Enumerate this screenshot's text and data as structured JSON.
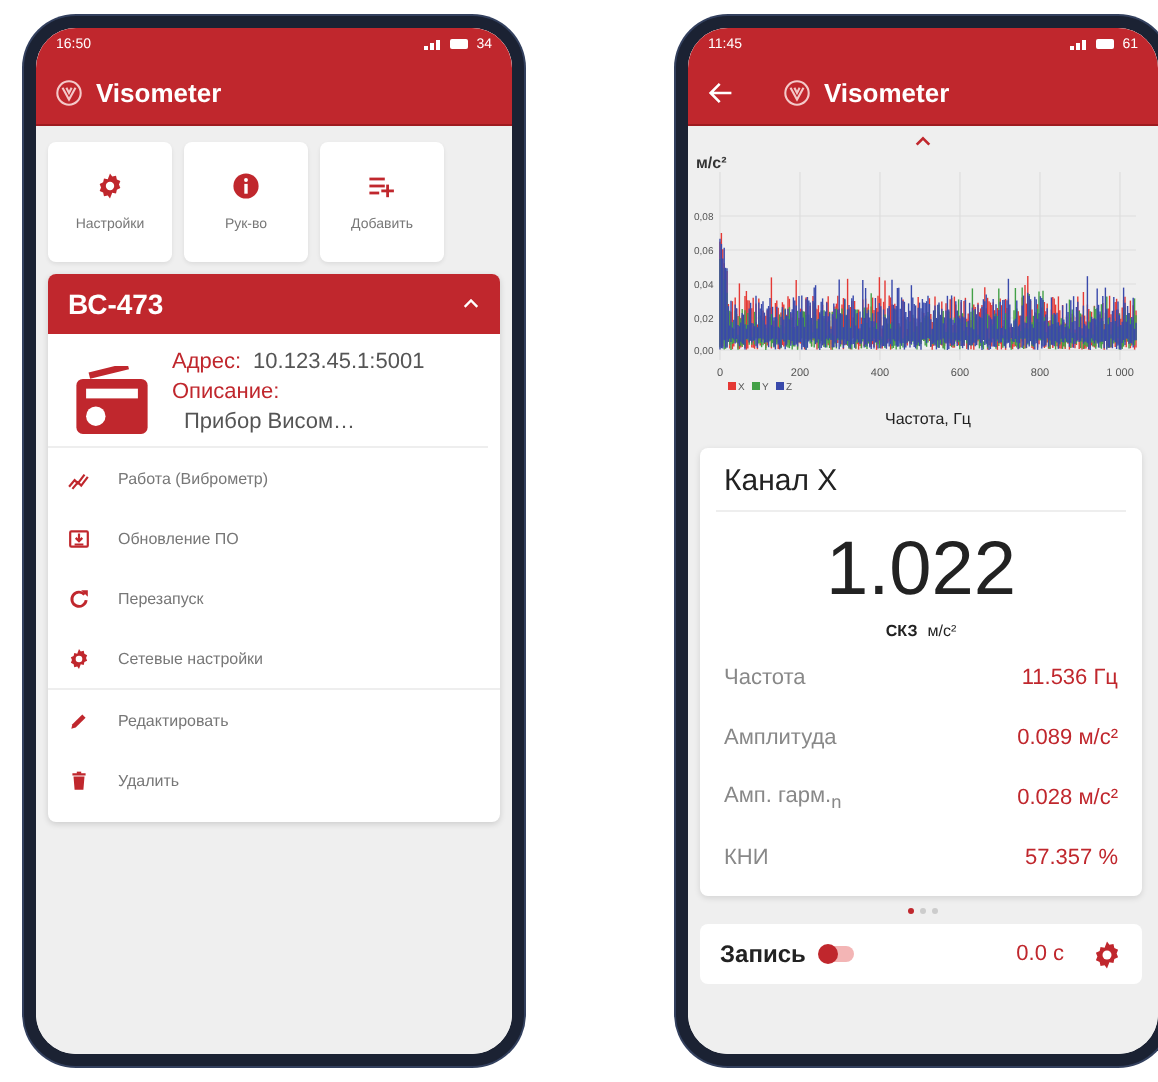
{
  "home": {
    "status_bar": {
      "time": "16:50",
      "battery": "34"
    },
    "app_bar": {
      "title": "Visometer"
    },
    "tiles": [
      {
        "kind": "settings",
        "label": "Настройки"
      },
      {
        "kind": "info",
        "label": "Рук-во"
      },
      {
        "kind": "add",
        "label": "Добавить"
      }
    ],
    "device": {
      "name": "ВС-473",
      "expanded": true,
      "address_label": "Адрес:",
      "address": "10.123.45.1:5001",
      "description_label": "Описание:",
      "description": "Прибор Висом…",
      "actions": [
        {
          "kind": "chart",
          "label": "Работа (Виброметр)"
        },
        {
          "kind": "update",
          "label": "Обновление ПО"
        },
        {
          "kind": "restart",
          "label": "Перезапуск"
        },
        {
          "kind": "network",
          "label": "Сетевые настройки"
        },
        {
          "kind": "edit",
          "label": "Редактировать"
        },
        {
          "kind": "delete",
          "label": "Удалить"
        }
      ]
    }
  },
  "measure": {
    "status_bar": {
      "time": "11:45",
      "battery": "61"
    },
    "app_bar": {
      "title": "Visometer"
    },
    "spectrum": {
      "y_unit": "м/с²",
      "y_ticks": [
        "0,08",
        "0,06",
        "0,04",
        "0,02",
        "0,00"
      ],
      "x_ticks": [
        "0",
        "200",
        "400",
        "600",
        "800",
        "1 000"
      ],
      "x_label": "Частота, Гц",
      "legend": [
        {
          "label": "X",
          "color": "#e53935"
        },
        {
          "label": "Y",
          "color": "#43a047"
        },
        {
          "label": "Z",
          "color": "#3949ab"
        }
      ]
    },
    "channel": {
      "title": "Канал X",
      "value": "1.022",
      "value_label": "СКЗ",
      "value_unit": "м/с²",
      "rows": [
        {
          "label": "Частота",
          "value": "11.536 Гц"
        },
        {
          "label": "Амплитуда",
          "value": "0.089 м/с²"
        },
        {
          "label": "Амп. гарм.$_{n}$",
          "value": "0.028 м/с²"
        },
        {
          "label": "КНИ",
          "value": "57.357 %"
        }
      ]
    },
    "pages": [
      {
        "selected": true
      },
      {
        "selected": false
      },
      {
        "selected": false
      }
    ],
    "record": {
      "label": "Запись",
      "on": false,
      "time": "0.0 с"
    }
  }
}
